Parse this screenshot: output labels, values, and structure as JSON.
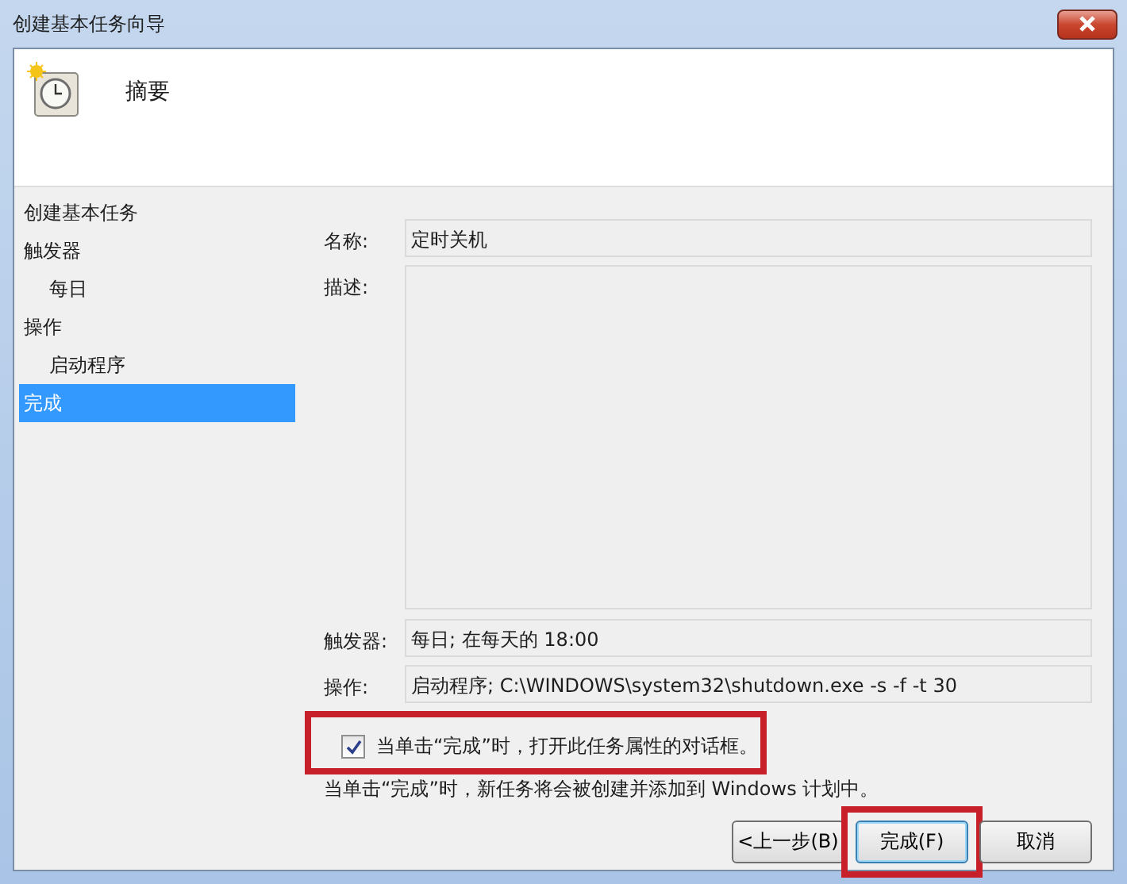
{
  "window": {
    "title": "创建基本任务向导"
  },
  "header": {
    "title": "摘要"
  },
  "sidebar": {
    "items": [
      {
        "label": "创建基本任务",
        "selected": false
      },
      {
        "label": "触发器",
        "selected": false,
        "children": [
          {
            "label": "每日",
            "selected": false
          }
        ]
      },
      {
        "label": "操作",
        "selected": false,
        "children": [
          {
            "label": "启动程序",
            "selected": false
          }
        ]
      },
      {
        "label": "完成",
        "selected": true
      }
    ]
  },
  "fields": [
    {
      "label": "名称:",
      "value": "定时关机",
      "kind": "line"
    },
    {
      "label": "描述:",
      "kind": "area"
    },
    {
      "label": "触发器:",
      "value": "每日; 在每天的 18:00",
      "kind": "line"
    },
    {
      "label": "操作:",
      "value": "启动程序; C:\\WINDOWS\\system32\\shutdown.exe -s -f -t 30",
      "kind": "line"
    }
  ],
  "open_properties": {
    "label": "当单击“完成”时，打开此任务属性的对话框。",
    "checked": true,
    "highlighted": true
  },
  "note": "当单击“完成”时，新任务将会被创建并添加到 Windows 计划中。",
  "buttons": [
    {
      "label": "<上一步(B)",
      "default": false,
      "highlighted": false
    },
    {
      "label": "完成(F)",
      "default": true,
      "highlighted": true
    },
    {
      "label": "取消",
      "default": false,
      "highlighted": false
    }
  ]
}
